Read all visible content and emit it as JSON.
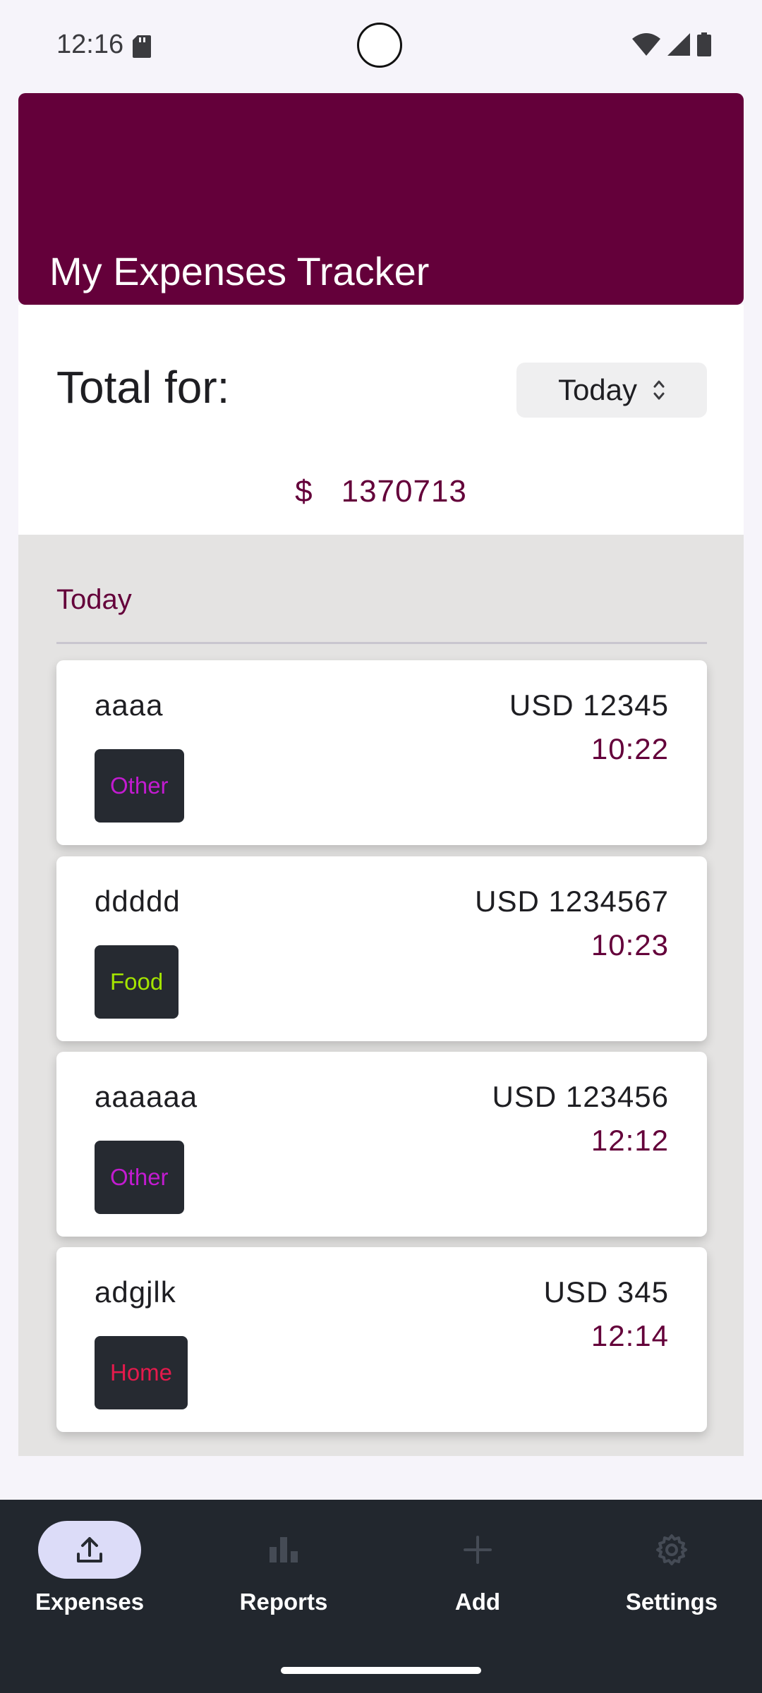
{
  "status_bar": {
    "time": "12:16"
  },
  "header": {
    "title": "My Expenses Tracker",
    "color": "#64003a"
  },
  "total": {
    "label": "Total for:",
    "period": "Today",
    "currency_symbol": "$",
    "amount": "1370713"
  },
  "list": {
    "section_title": "Today",
    "items": [
      {
        "name": "aaaa",
        "amount": "USD 12345",
        "time": "10:22",
        "category": "Other",
        "category_color": "#c21bd0"
      },
      {
        "name": "ddddd",
        "amount": "USD 1234567",
        "time": "10:23",
        "category": "Food",
        "category_color": "#a4e400"
      },
      {
        "name": "aaaaaa",
        "amount": "USD 123456",
        "time": "12:12",
        "category": "Other",
        "category_color": "#c21bd0"
      },
      {
        "name": "adgjlk",
        "amount": "USD 345",
        "time": "12:14",
        "category": "Home",
        "category_color": "#e41a4c"
      }
    ]
  },
  "nav": {
    "items": [
      {
        "label": "Expenses",
        "icon": "upload-icon",
        "active": true
      },
      {
        "label": "Reports",
        "icon": "bar-chart-icon",
        "active": false
      },
      {
        "label": "Add",
        "icon": "plus-icon",
        "active": false
      },
      {
        "label": "Settings",
        "icon": "gear-icon",
        "active": false
      }
    ]
  }
}
